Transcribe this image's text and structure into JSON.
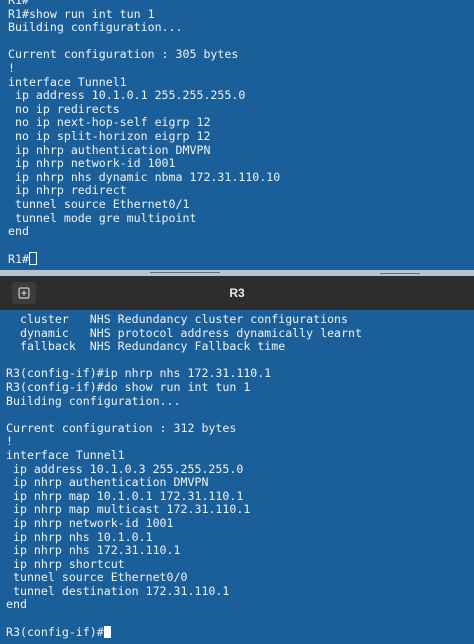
{
  "r1": {
    "lines": [
      "R1#",
      "R1#show run int tun 1",
      "Building configuration...",
      "",
      "Current configuration : 305 bytes",
      "!",
      "interface Tunnel1",
      " ip address 10.1.0.1 255.255.255.0",
      " no ip redirects",
      " no ip next-hop-self eigrp 12",
      " no ip split-horizon eigrp 12",
      " ip nhrp authentication DMVPN",
      " ip nhrp network-id 1001",
      " ip nhrp nhs dynamic nbma 172.31.110.10",
      " ip nhrp redirect",
      " tunnel source Ethernet0/1",
      " tunnel mode gre multipoint",
      "end",
      ""
    ],
    "prompt": "R1#"
  },
  "r3": {
    "title": "R3",
    "new_tab_icon": "new-tab-icon",
    "lines": [
      "  cluster   NHS Redundancy cluster configurations",
      "  dynamic   NHS protocol address dynamically learnt",
      "  fallback  NHS Redundancy Fallback time",
      "",
      "R3(config-if)#ip nhrp nhs 172.31.110.1",
      "R3(config-if)#do show run int tun 1",
      "Building configuration...",
      "",
      "Current configuration : 312 bytes",
      "!",
      "interface Tunnel1",
      " ip address 10.1.0.3 255.255.255.0",
      " ip nhrp authentication DMVPN",
      " ip nhrp map 10.1.0.1 172.31.110.1",
      " ip nhrp map multicast 172.31.110.1",
      " ip nhrp network-id 1001",
      " ip nhrp nhs 10.1.0.1",
      " ip nhrp nhs 172.31.110.1",
      " ip nhrp shortcut",
      " tunnel source Ethernet0/0",
      " tunnel destination 172.31.110.1",
      "end",
      ""
    ],
    "prompt": "R3(config-if)#"
  }
}
